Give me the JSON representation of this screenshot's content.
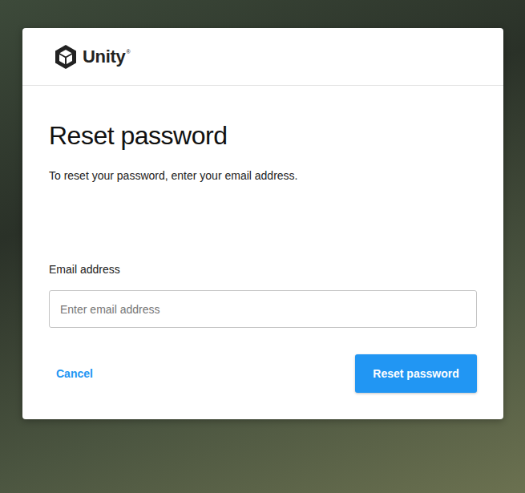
{
  "logo": {
    "text": "Unity",
    "mark": "®"
  },
  "dialog": {
    "title": "Reset password",
    "description": "To reset your password, enter your email address.",
    "email": {
      "label": "Email address",
      "placeholder": "Enter email address"
    },
    "buttons": {
      "cancel": "Cancel",
      "submit": "Reset password"
    }
  }
}
